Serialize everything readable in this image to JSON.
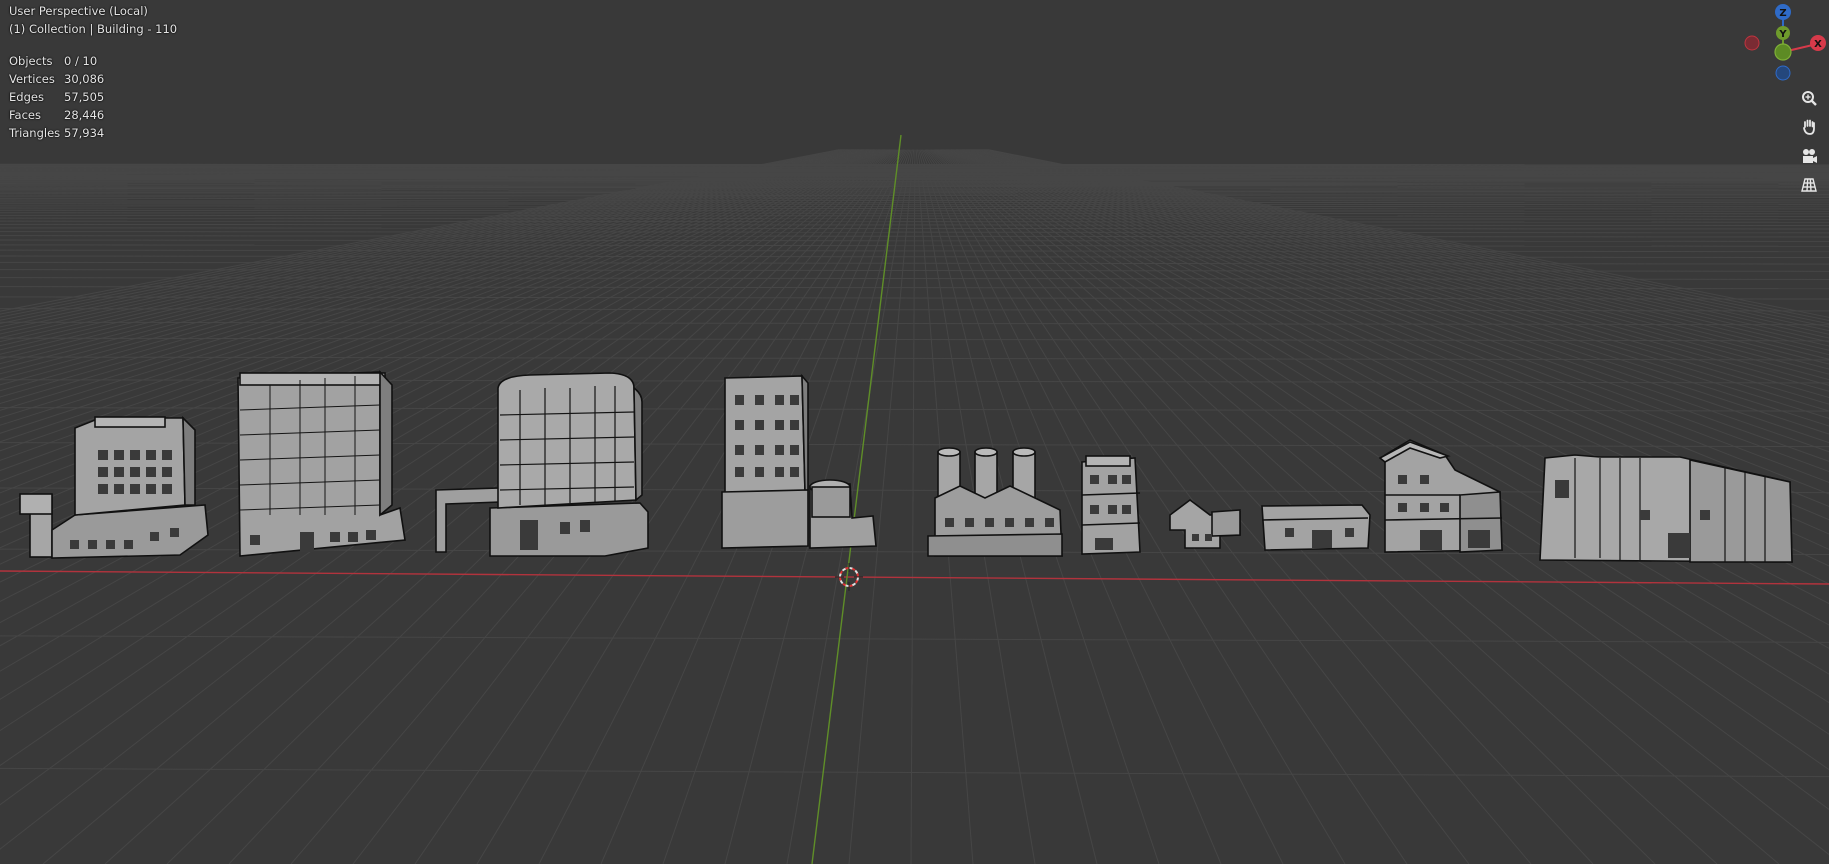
{
  "viewport": {
    "mode_label": "User Perspective (Local)",
    "context_label": "(1) Collection | Building - 110",
    "stats": [
      {
        "label": "Objects",
        "value": "0 / 10"
      },
      {
        "label": "Vertices",
        "value": "30,086"
      },
      {
        "label": "Edges",
        "value": "57,505"
      },
      {
        "label": "Faces",
        "value": "28,446"
      },
      {
        "label": "Triangles",
        "value": "57,934"
      }
    ]
  },
  "gizmo": {
    "axes": [
      {
        "label": "Z",
        "color": "#2f6bc8"
      },
      {
        "label": "Y",
        "color": "#6e9b2c"
      },
      {
        "label": "X",
        "color": "#d63a4a"
      }
    ]
  },
  "navigation": {
    "buttons": [
      {
        "icon": "zoom-icon"
      },
      {
        "icon": "pan-hand-icon"
      },
      {
        "icon": "camera-icon"
      },
      {
        "icon": "ortho-grid-icon"
      }
    ]
  },
  "colors": {
    "background": "#393939",
    "grid_line": "#454545",
    "x_axis": "#c0353f",
    "y_axis": "#6a9b2c",
    "building_fill": "#9c9c9c",
    "building_edge": "#101010"
  }
}
